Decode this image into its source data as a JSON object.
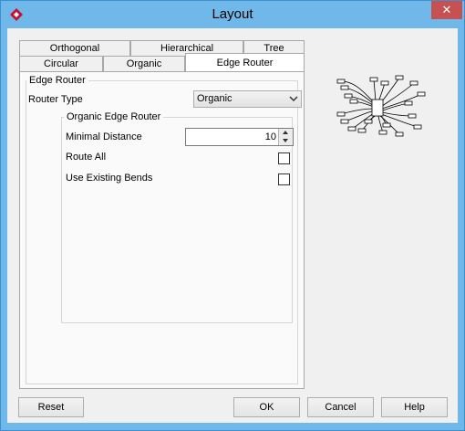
{
  "window": {
    "title": "Layout",
    "close_glyph": "✕"
  },
  "tabs": {
    "back_row": [
      "Orthogonal",
      "Hierarchical",
      "Tree"
    ],
    "front_row": [
      "Circular",
      "Organic",
      "Edge Router"
    ],
    "active": "Edge Router"
  },
  "edge_router": {
    "group_label": "Edge Router",
    "router_type_label": "Router Type",
    "router_type_value": "Organic",
    "organic_group_label": "Organic Edge Router",
    "minimal_distance_label": "Minimal Distance",
    "minimal_distance_value": "10",
    "route_all_label": "Route All",
    "route_all_checked": false,
    "use_existing_bends_label": "Use Existing Bends",
    "use_existing_bends_checked": false
  },
  "preview": {
    "icon": "organic-edge-router-preview-icon"
  },
  "buttons": {
    "reset": "Reset",
    "ok": "OK",
    "cancel": "Cancel",
    "help": "Help"
  },
  "colors": {
    "title_bar": "#71b8ea",
    "close_button": "#c75050",
    "dialog_bg": "#f0f0f0",
    "app_icon": "#c8102e"
  }
}
